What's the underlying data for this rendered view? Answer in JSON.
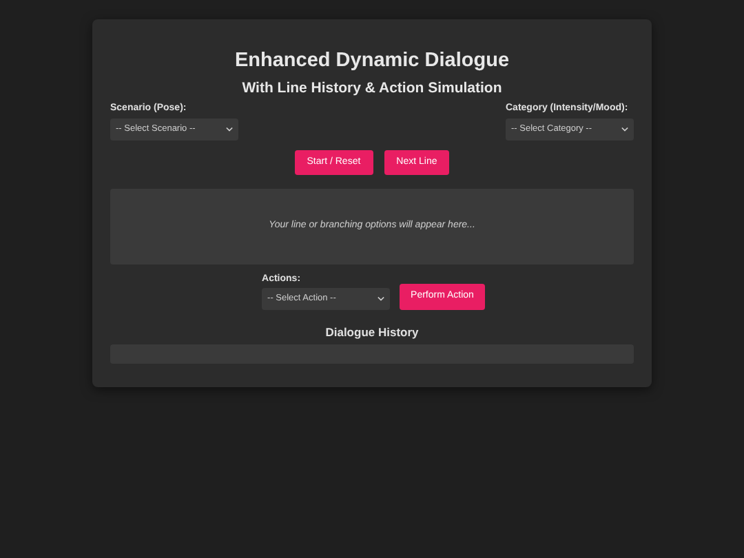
{
  "title": "Enhanced Dynamic Dialogue",
  "subtitle": "With Line History & Action Simulation",
  "scenario": {
    "label": "Scenario (Pose):",
    "value": "-- Select Scenario --"
  },
  "category": {
    "label": "Category (Intensity/Mood):",
    "value": "-- Select Category --"
  },
  "buttons": [
    "Start / Reset",
    "Next Line"
  ],
  "output": {
    "message": "Your line or branching options will appear here..."
  },
  "actions": {
    "label": "Actions:",
    "value": "-- Select Action --",
    "button": "Perform Action"
  },
  "history": {
    "heading": "Dialogue History"
  }
}
